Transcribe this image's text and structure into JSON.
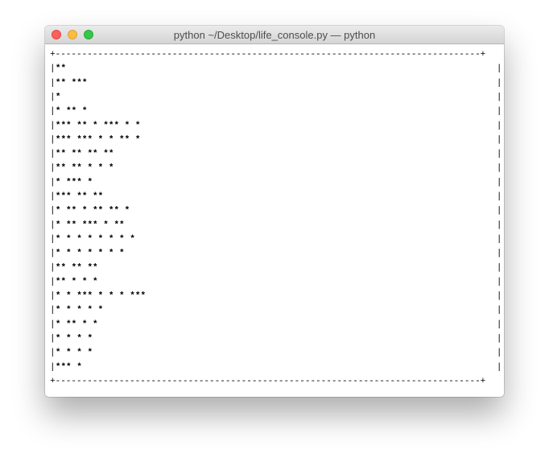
{
  "window": {
    "title": "python ~/Desktop/life_console.py — python"
  },
  "terminal": {
    "border": {
      "corner": "+",
      "horizontal": "-",
      "vertical": "|"
    },
    "grid_lines": [
      "                          **                                                  ",
      "                          **                                   ***            ",
      "                                                                 *             ",
      "        *                                                     **     *         ",
      "       *** **            *                                   ***  *  *         ",
      "       *** ***          * *                                   **    *          ",
      "            **           **                   **                  **           ",
      "            **                                **                * *    *       ",
      "         *                                                      ***     *      ",
      "                           ***                                       ** **     ",
      "                          *  **     *                           **    ** *      ",
      "                          *   **   ***                          *     **        ",
      "                          *    * * * * *                        *     *         ",
      "                           *   *  *  *  *                        * *           ",
      "                            ** **                                 **            ",
      "                              **    *  *   *                                   ",
      "           * *                ***  * * * ***                                   ",
      "            *             *     *    *    *                                    ",
      "                          *      **    * *                                     ",
      "                          *       *   *                          *              ",
      "                                  * * *                          *              ",
      "                                   ***                           *              "
    ],
    "colors": {
      "background": "#ffffff",
      "text": "#000000"
    }
  }
}
